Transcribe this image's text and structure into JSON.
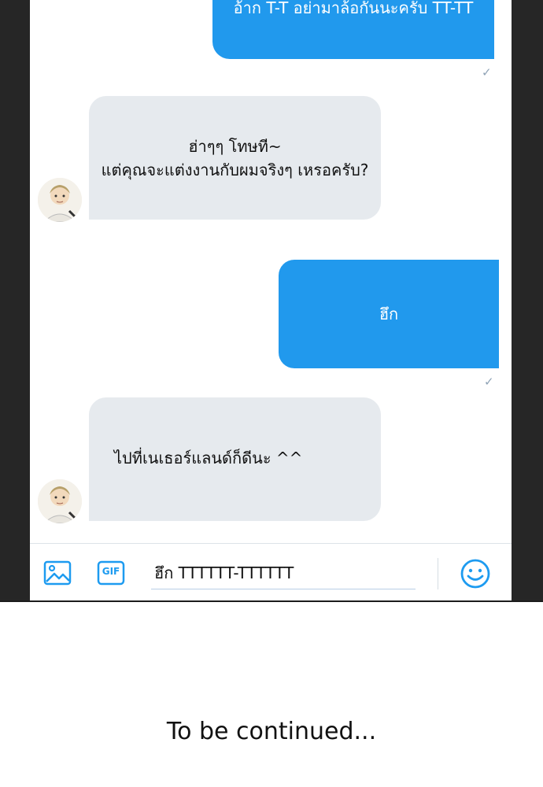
{
  "messages": [
    {
      "direction": "outgoing",
      "text": "อ้าก T-T อย่ามาล้อกันนะครับ TT-TT",
      "status_icon": "check-icon"
    },
    {
      "direction": "incoming",
      "text": "ฮ่าๆๆ โทษที~\nแต่คุณจะแต่งงานกับผมจริงๆ เหรอครับ?",
      "avatar": "avatar-icon"
    },
    {
      "direction": "outgoing",
      "text": "ฮึก",
      "status_icon": "check-icon"
    },
    {
      "direction": "incoming",
      "text": "ไปที่เนเธอร์แลนด์ก็ดีนะ ^^",
      "avatar": "avatar-icon"
    }
  ],
  "composer": {
    "value": "ฮึก TTTTTT-TTTTTT",
    "image_button_icon": "image-icon",
    "gif_label": "GIF",
    "emoji_button_icon": "emoji-icon"
  },
  "caption": "To be continued...",
  "colors": {
    "outgoing_bubble": "#2199ed",
    "incoming_bubble": "#e6eaee",
    "accent": "#1d9bf0",
    "frame": "#262626"
  }
}
